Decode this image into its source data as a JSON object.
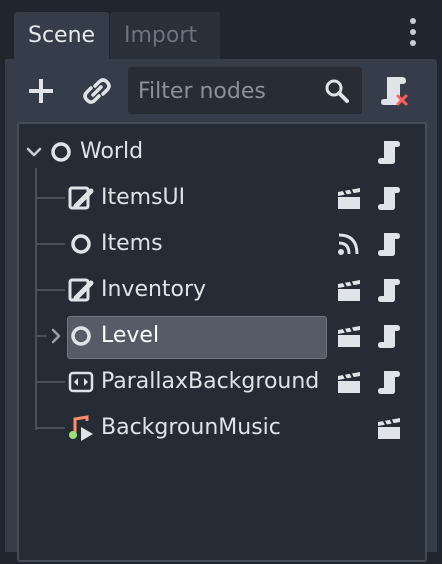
{
  "tabs": [
    {
      "label": "Scene",
      "active": true
    },
    {
      "label": "Import",
      "active": false
    }
  ],
  "toolbar": {
    "add_icon": "plus-icon",
    "link_icon": "link-icon",
    "filter_placeholder": "Filter nodes",
    "search_icon": "search-icon",
    "detach_icon": "script-remove-icon"
  },
  "tree": {
    "root": {
      "label": "World",
      "icon": "node-circle-icon",
      "expanded": true
    },
    "children": [
      {
        "label": "ItemsUI",
        "icon": "control-icon"
      },
      {
        "label": "Items",
        "icon": "node-circle-icon"
      },
      {
        "label": "Inventory",
        "icon": "control-icon"
      },
      {
        "label": "Level",
        "icon": "node-circle-icon",
        "selected": true,
        "collapsed": true
      },
      {
        "label": "ParallaxBackground",
        "icon": "parallax-icon"
      },
      {
        "label": "BackgrounMusic",
        "icon": "audio-icon"
      }
    ]
  },
  "colors": {
    "background": "#21262e",
    "panel": "#363d4a",
    "tree_bg": "#262c35",
    "selection": "#555c68",
    "icon_light": "#e0e3e8"
  }
}
